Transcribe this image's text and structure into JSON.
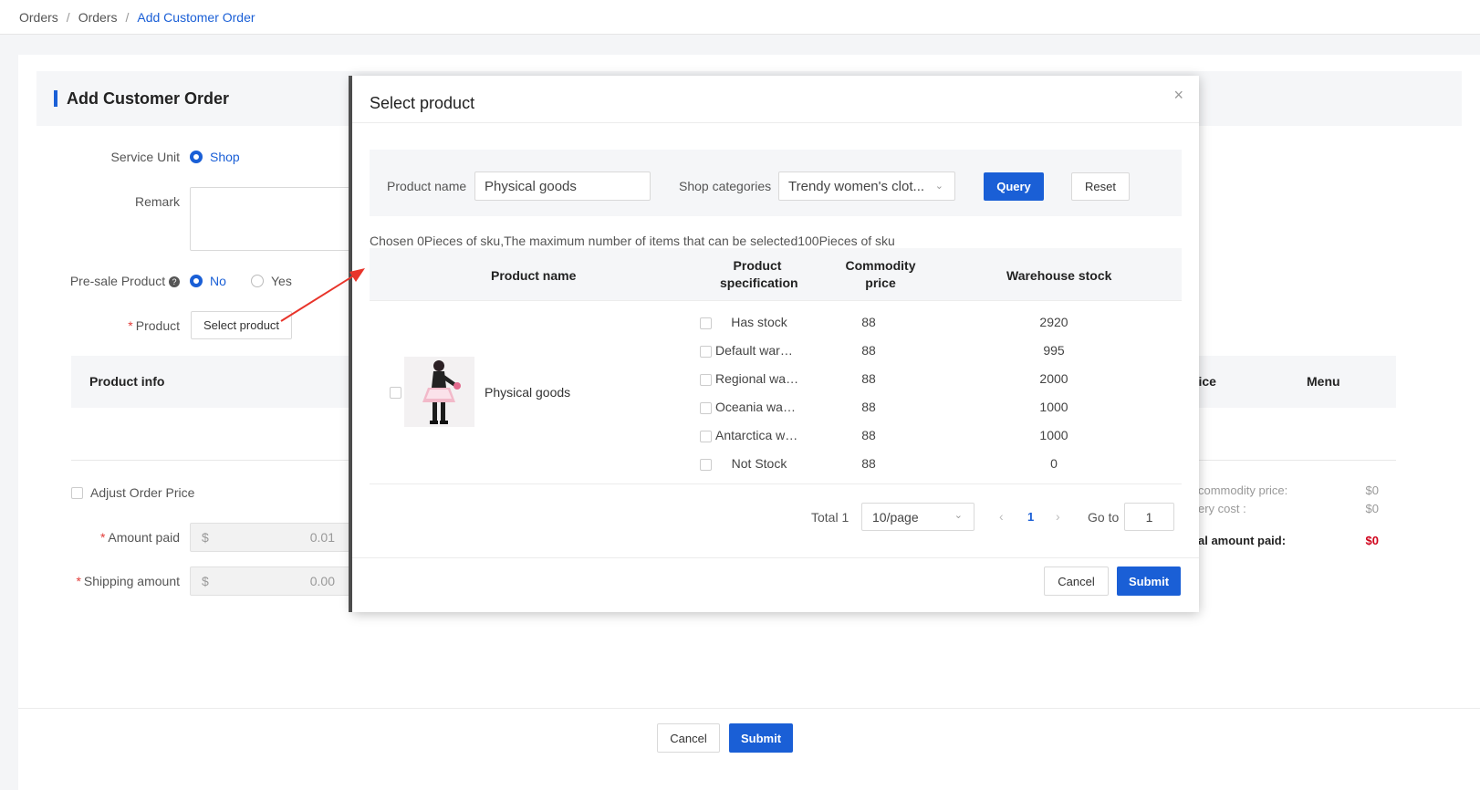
{
  "breadcrumb": [
    "Orders",
    "Orders",
    "Add Customer Order"
  ],
  "page": {
    "title": "Add Customer Order",
    "service_unit_label": "Service Unit",
    "service_unit_option": "Shop",
    "remark_label": "Remark",
    "presale_label": "Pre-sale Product",
    "presale_yes": "Yes",
    "presale_no": "No",
    "product_label": "Product",
    "select_product_button": "Select product",
    "product_info_header": "Product info",
    "price_header_partial": "rice",
    "menu_header": "Menu",
    "adjust_price_label": "Adjust Order Price",
    "amount_paid_label": "Amount paid",
    "amount_paid_currency": "$",
    "amount_paid_value": "0.01",
    "shipping_label": "Shipping amount",
    "shipping_currency": "$",
    "shipping_value": "0.00",
    "summary": {
      "commodity_price_label": "commodity price:",
      "commodity_price_value": "$0",
      "delivery_cost_label": "ery cost :",
      "delivery_cost_value": "$0",
      "total_label": "al amount paid:",
      "total_value": "$0"
    },
    "cancel_button": "Cancel",
    "submit_button": "Submit"
  },
  "modal": {
    "title": "Select product",
    "close_icon": "×",
    "filter": {
      "product_name_label": "Product name",
      "product_name_value": "Physical goods",
      "shop_categories_label": "Shop categories",
      "shop_categories_value": "Trendy women's clot...",
      "query_button": "Query",
      "reset_button": "Reset"
    },
    "chosen_text": "Chosen 0Pieces of sku,The maximum number of items that can be selected100Pieces of sku",
    "columns": {
      "product_name": "Product name",
      "product_spec_line1": "Product",
      "product_spec_line2": "specification",
      "commodity_price_line1": "Commodity",
      "commodity_price_line2": "price",
      "warehouse_stock": "Warehouse stock"
    },
    "product": {
      "name": "Physical goods",
      "skus": [
        {
          "spec": "Has stock",
          "price": "88",
          "stock": "2920"
        },
        {
          "spec": "Default warehouse",
          "price": "88",
          "stock": "995"
        },
        {
          "spec": "Regional warehouse",
          "price": "88",
          "stock": "2000"
        },
        {
          "spec": "Oceania warehouse",
          "price": "88",
          "stock": "1000"
        },
        {
          "spec": "Antarctica warehouse",
          "price": "88",
          "stock": "1000"
        },
        {
          "spec": "Not Stock",
          "price": "88",
          "stock": "0"
        }
      ]
    },
    "pagination": {
      "total": "Total 1",
      "page_size": "10/page",
      "current_page": "1",
      "goto_label": "Go to",
      "goto_value": "1"
    },
    "cancel_button": "Cancel",
    "submit_button": "Submit"
  },
  "colors": {
    "primary": "#1a5fd6",
    "required": "#e23c39",
    "total_red": "#d0021b",
    "annotation_arrow": "#e8342a"
  }
}
